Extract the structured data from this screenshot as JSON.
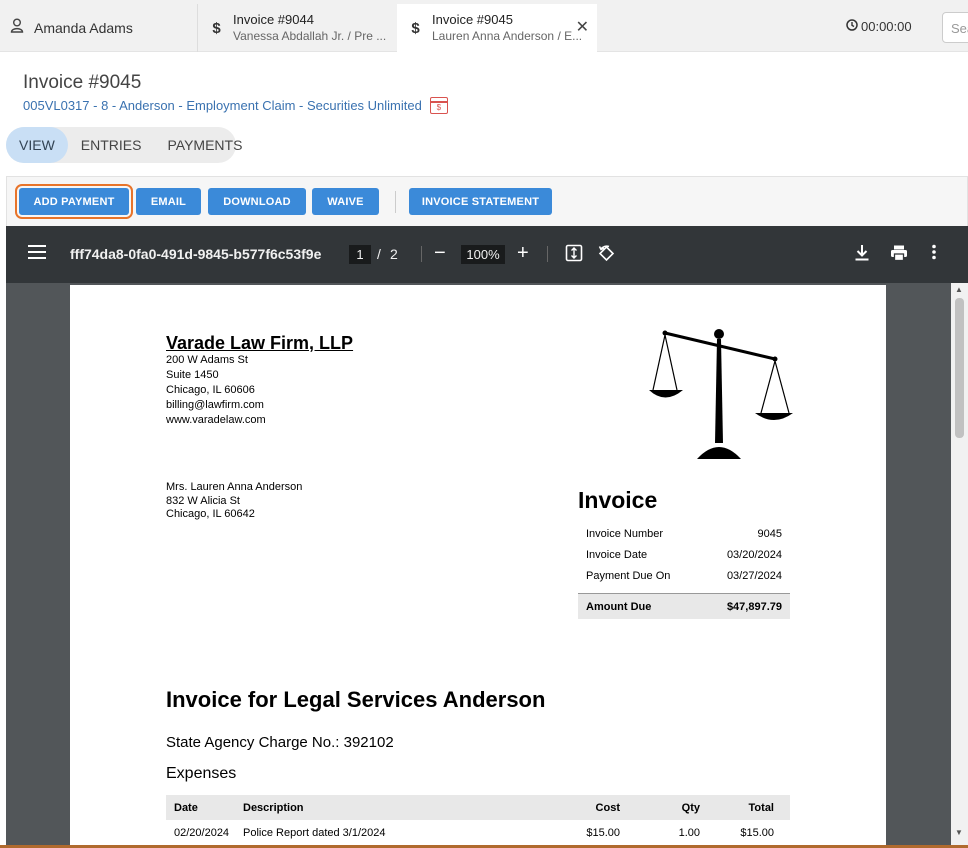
{
  "tabs": {
    "user": "Amanda Adams",
    "tab1": {
      "title": "Invoice #9044",
      "subtitle": "Vanessa Abdallah Jr. / Pre ..."
    },
    "tab2": {
      "title": "Invoice #9045",
      "subtitle": "Lauren Anna Anderson / E..."
    },
    "timer": "00:00:00",
    "search_placeholder": "Search"
  },
  "header": {
    "title": "Invoice #9045",
    "matter": "005VL0317 - 8 - Anderson - Employment Claim - Securities Unlimited",
    "calendar_glyph": "$"
  },
  "view_tabs": [
    "VIEW",
    "ENTRIES",
    "PAYMENTS"
  ],
  "toolbar": {
    "add_payment": "ADD PAYMENT",
    "email": "EMAIL",
    "download": "DOWNLOAD",
    "waive": "WAIVE",
    "invoice_statement": "INVOICE STATEMENT"
  },
  "pdf": {
    "filename": "fff74da8-0fa0-491d-9845-b577f6c53f9e",
    "page": "1",
    "page_total": "2",
    "zoom": "100%"
  },
  "document": {
    "firm_name": "Varade Law Firm, LLP",
    "firm_address": [
      "200 W Adams St",
      "Suite 1450",
      "Chicago, IL 60606",
      "billing@lawfirm.com",
      "www.varadelaw.com"
    ],
    "client_address": [
      "Mrs. Lauren Anna Anderson",
      "832 W Alicia St",
      "Chicago, IL 60642"
    ],
    "invoice_heading": "Invoice",
    "invoice_number_label": "Invoice Number",
    "invoice_number": "9045",
    "invoice_date_label": "Invoice Date",
    "invoice_date": "03/20/2024",
    "due_on_label": "Payment Due On",
    "due_on": "03/27/2024",
    "amount_due_label": "Amount Due",
    "amount_due": "$47,897.79",
    "services_heading": "Invoice for Legal Services Anderson",
    "charge_no": "State Agency Charge No.: 392102",
    "expenses_heading": "Expenses",
    "expense_headers": [
      "Date",
      "Description",
      "Cost",
      "Qty",
      "Total"
    ],
    "expense_rows": [
      [
        "02/20/2024",
        "Police Report dated 3/1/2024",
        "$15.00",
        "1.00",
        "$15.00"
      ]
    ]
  }
}
